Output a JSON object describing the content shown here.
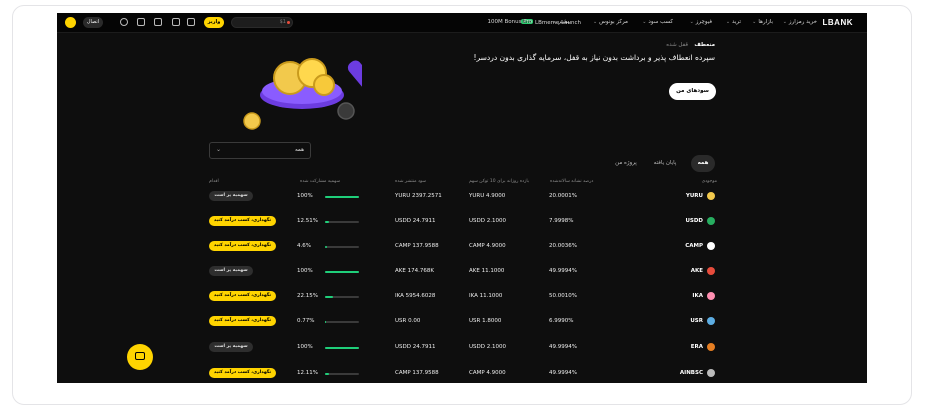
{
  "topbar": {
    "logo": "LBANK",
    "nav": [
      {
        "label": "خرید رمزارز",
        "chev": true
      },
      {
        "label": "بازارها",
        "chev": true
      },
      {
        "label": "ترید",
        "chev": true
      },
      {
        "label": "فیوچرز",
        "chev": true
      },
      {
        "label": "کسب سود",
        "chev": true
      },
      {
        "label": "مرکز بونوس",
        "chev": true
      },
      {
        "label": "LBmeme Launch",
        "badge": "New"
      },
      {
        "label": "بیشتر",
        "chev": true
      },
      {
        "label": "100M Bonus Pro"
      }
    ],
    "search_text": "$1",
    "deposit_label": "واریز",
    "connect_label": "اتصال"
  },
  "hero": {
    "tab_active": "منعطف",
    "tab_other": "قفل شده",
    "title": "سپرده انعطاف پذیر و برداشت بدون نیاز به قفل، سرمایه گذاری بدون دردسر!",
    "my_earnings_button": "سودهای من"
  },
  "filters": {
    "tabs": [
      "همه",
      "پایان یافته",
      "پروژه من"
    ],
    "select_value": "همه"
  },
  "table": {
    "headers": [
      "موجودی",
      "درصد نشانه سالانه‌شده",
      "بازده روزانه برای 10 توکن سهم",
      "سود منتشر شده",
      "سهمیه مشارکت شده",
      "اقدام"
    ],
    "rows": [
      {
        "coin": "YURU",
        "apr": "20.0001%",
        "daily": "YURU 4.9000",
        "released": "YURU 2397.2571",
        "percent": "100%",
        "fill": 1.0,
        "action": "سهمیه پر است",
        "action_style": "dark",
        "color": "#f2c94c"
      },
      {
        "coin": "USDD",
        "apr": "7.9998%",
        "daily": "USDD 2.1000",
        "released": "USDD 24.7911",
        "percent": "12.51%",
        "fill": 0.1251,
        "action": "نگهداری، کسب درآمد کنید",
        "action_style": "yellow",
        "color": "#27ae60"
      },
      {
        "coin": "CAMP",
        "apr": "20.0036%",
        "daily": "CAMP 4.9000",
        "released": "CAMP 137.9588",
        "percent": "4.6%",
        "fill": 0.046,
        "action": "نگهداری، کسب درآمد کنید",
        "action_style": "yellow",
        "color": "#ffffff"
      },
      {
        "coin": "AKE",
        "apr": "49.9994%",
        "daily": "AKE 11.1000",
        "released": "AKE 174.768K",
        "percent": "100%",
        "fill": 1.0,
        "action": "سهمیه پر است",
        "action_style": "dark",
        "color": "#e74c3c"
      },
      {
        "coin": "IKA",
        "apr": "50.0010%",
        "daily": "IKA 11.1000",
        "released": "IKA 5954.6028",
        "percent": "22.15%",
        "fill": 0.2215,
        "action": "نگهداری، کسب درآمد کنید",
        "action_style": "yellow",
        "color": "#ff8fb1"
      },
      {
        "coin": "USR",
        "apr": "6.9990%",
        "daily": "USR 1.8000",
        "released": "USR 0.00",
        "percent": "0.77%",
        "fill": 0.0077,
        "action": "نگهداری، کسب درآمد کنید",
        "action_style": "yellow",
        "color": "#5dade2"
      },
      {
        "coin": "ERA",
        "apr": "49.9994%",
        "daily": "USDD 2.1000",
        "released": "USDD 24.7911",
        "percent": "100%",
        "fill": 1.0,
        "action": "سهمیه پر است",
        "action_style": "dark",
        "color": "#e67e22"
      },
      {
        "coin": "AINBSC",
        "apr": "49.9994%",
        "daily": "CAMP 4.9000",
        "released": "CAMP 137.9588",
        "percent": "12.11%",
        "fill": 0.1211,
        "action": "نگهداری، کسب درآمد کنید",
        "action_style": "yellow",
        "color": "#bbbbbb"
      }
    ]
  },
  "colors": {
    "accent": "#ffd400",
    "progress": "#1fcf7a",
    "background": "#0e0e0e"
  }
}
